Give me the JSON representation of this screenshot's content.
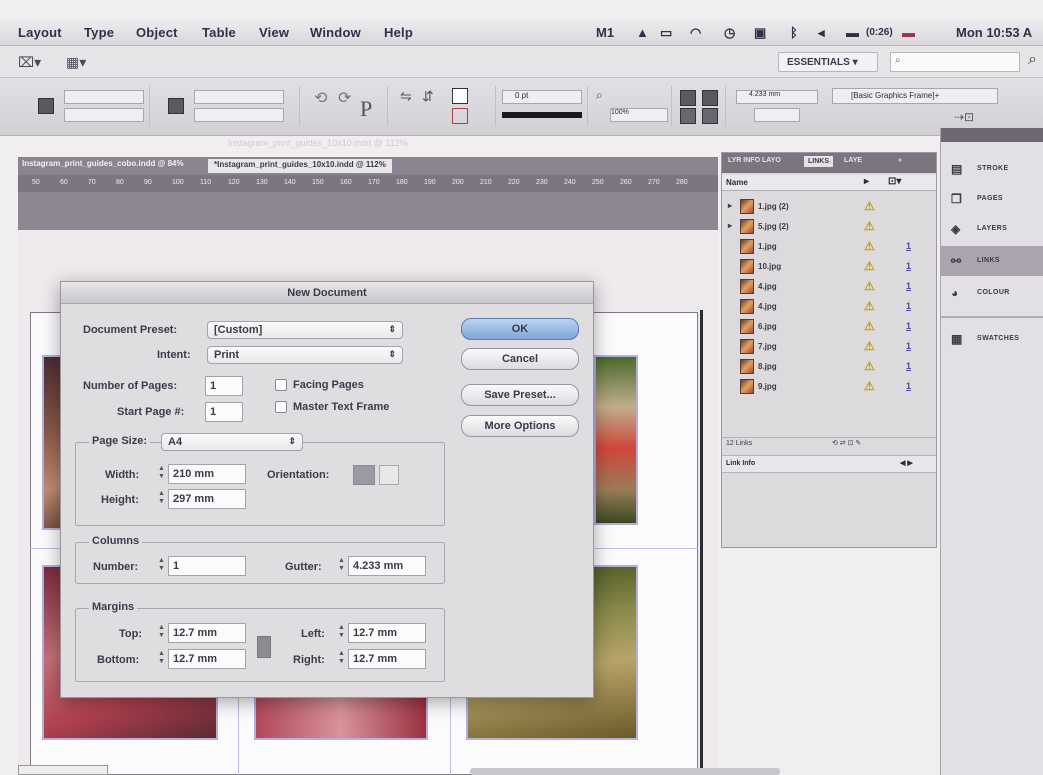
{
  "menubar": {
    "items": [
      "Layout",
      "Type",
      "Object",
      "Table",
      "View",
      "Window",
      "Help"
    ],
    "status_icons": [
      "m1-icon",
      "adobe-icon",
      "monitor-icon",
      "wifi-icon",
      "clock-icon",
      "display-icon",
      "bluetooth-icon",
      "volume-icon",
      "battery-icon"
    ],
    "battery_text": "(0:26)",
    "clock": "Mon 10:53 A"
  },
  "appbar": {
    "workspace_label": "ESSENTIALS ▾"
  },
  "control_panel": {
    "char_label": "P",
    "stroke_weight": "0 pt",
    "percent": "100%",
    "offset": "4.233 mm",
    "frame_style": "[Basic Graphics Frame]+"
  },
  "document": {
    "ghost_title": "Instagram_print_guides_10x10.indd @ 112%",
    "tabs": [
      "Instagram_print_guides_cobo.indd @ 84%",
      "*Instagram_print_guides_10x10.indd @ 112%"
    ],
    "ruler_marks": [
      "50",
      "60",
      "70",
      "80",
      "90",
      "100",
      "110",
      "120",
      "130",
      "140",
      "150",
      "160",
      "170",
      "180",
      "190",
      "200",
      "210",
      "220",
      "230",
      "240",
      "250",
      "260",
      "270",
      "280"
    ]
  },
  "dialog": {
    "title": "New Document",
    "labels": {
      "preset": "Document Preset:",
      "intent": "Intent:",
      "pages": "Number of Pages:",
      "start": "Start Page #:",
      "facing": "Facing Pages",
      "master": "Master Text Frame",
      "page_size": "Page Size:",
      "width": "Width:",
      "height": "Height:",
      "orientation": "Orientation:",
      "columns": "Columns",
      "number": "Number:",
      "gutter": "Gutter:",
      "margins": "Margins",
      "top": "Top:",
      "bottom": "Bottom:",
      "left": "Left:",
      "right": "Right:"
    },
    "values": {
      "preset": "[Custom]",
      "intent": "Print",
      "pages": "1",
      "start": "1",
      "page_size": "A4",
      "width": "210 mm",
      "height": "297 mm",
      "number": "1",
      "gutter": "4.233 mm",
      "top": "12.7 mm",
      "bottom": "12.7 mm",
      "left": "12.7 mm",
      "right": "12.7 mm"
    },
    "buttons": {
      "ok": "OK",
      "cancel": "Cancel",
      "save_preset": "Save Preset...",
      "more_options": "More Options"
    }
  },
  "links_panel": {
    "tabs": [
      "LYR INFO LAYO",
      "LINKS",
      "LAYE"
    ],
    "column_name": "Name",
    "rows": [
      {
        "name": "1.jpg (2)",
        "page": ""
      },
      {
        "name": "5.jpg (2)",
        "page": ""
      },
      {
        "name": "1.jpg",
        "page": "1"
      },
      {
        "name": "10.jpg",
        "page": "1"
      },
      {
        "name": "4.jpg",
        "page": "1"
      },
      {
        "name": "4.jpg",
        "page": "1"
      },
      {
        "name": "6.jpg",
        "page": "1"
      },
      {
        "name": "7.jpg",
        "page": "1"
      },
      {
        "name": "8.jpg",
        "page": "1"
      },
      {
        "name": "9.jpg",
        "page": "1"
      }
    ],
    "footer": "12 Links",
    "info_label": "Link Info"
  },
  "dock": {
    "items": [
      {
        "label": "STROKE",
        "icon": "stroke-icon",
        "glyph": "▤"
      },
      {
        "label": "PAGES",
        "icon": "pages-icon",
        "glyph": "❐"
      },
      {
        "label": "LAYERS",
        "icon": "layers-icon",
        "glyph": "◈"
      },
      {
        "label": "LINKS",
        "icon": "links-icon",
        "glyph": "⚯"
      },
      {
        "label": "COLOUR",
        "icon": "colour-icon",
        "glyph": "◕"
      },
      {
        "label": "SWATCHES",
        "icon": "swatches-icon",
        "glyph": "▦"
      }
    ]
  }
}
